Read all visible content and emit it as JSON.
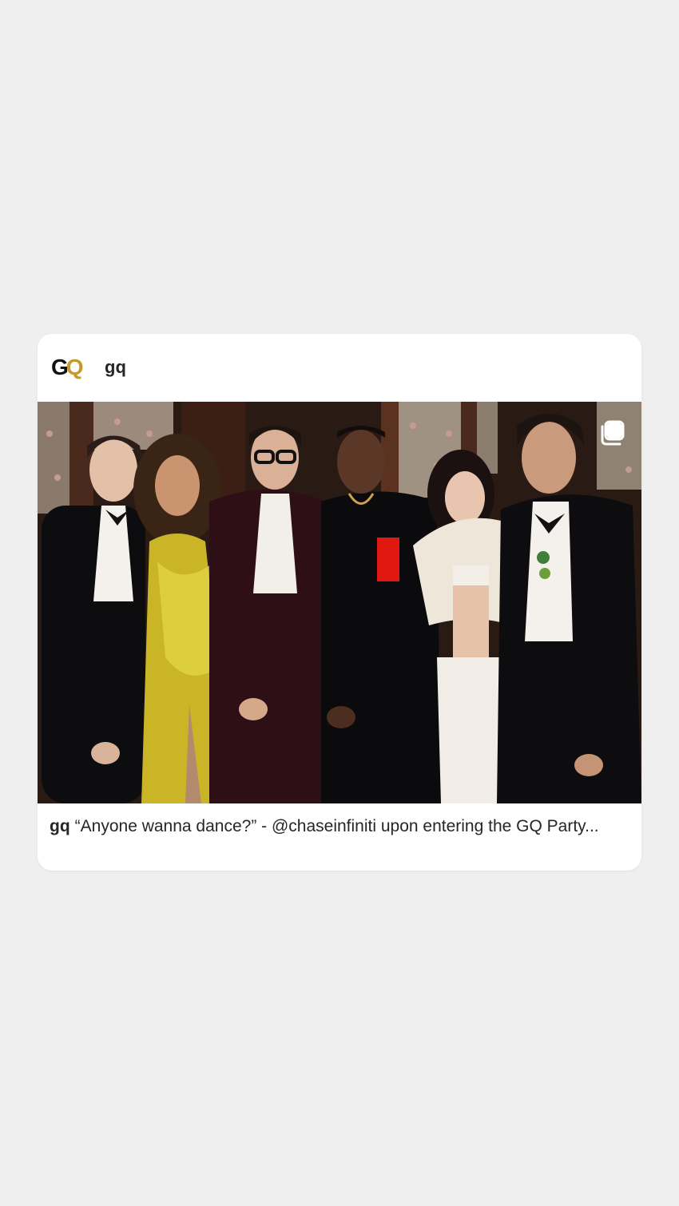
{
  "post": {
    "avatar_logo": {
      "text_dark": "G",
      "text_gold": "Q",
      "colors": {
        "dark": "#111111",
        "gold": "#c59a2b"
      }
    },
    "username": "gq",
    "media_indicator_icon": "multiple-images-icon",
    "caption": {
      "username": "gq",
      "text": "“Anyone wanna dance?” - @chaseinfiniti upon entering the GQ Party..."
    }
  },
  "colors": {
    "page_background": "#efefef",
    "card_background": "#ffffff",
    "text_primary": "#262626"
  }
}
